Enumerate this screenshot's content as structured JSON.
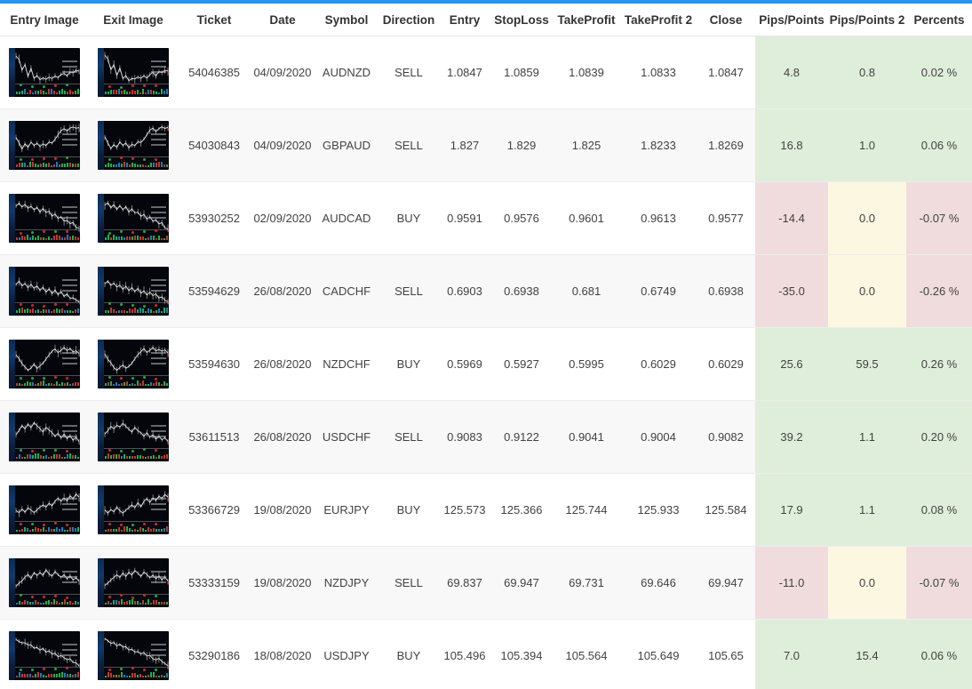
{
  "theme": {
    "accent": "#2196f3",
    "positive_bg": "#dfeeda",
    "negative_bg": "#f0dcdc",
    "zero_bg": "#fcf7e1",
    "row_odd_bg": "#ffffff",
    "row_even_bg": "#f8f8f8"
  },
  "table": {
    "columns": [
      {
        "key": "entry_image",
        "label": "Entry Image"
      },
      {
        "key": "exit_image",
        "label": "Exit Image"
      },
      {
        "key": "ticket",
        "label": "Ticket"
      },
      {
        "key": "date",
        "label": "Date"
      },
      {
        "key": "symbol",
        "label": "Symbol"
      },
      {
        "key": "direction",
        "label": "Direction"
      },
      {
        "key": "entry",
        "label": "Entry"
      },
      {
        "key": "stoploss",
        "label": "StopLoss"
      },
      {
        "key": "takeprofit",
        "label": "TakeProfit"
      },
      {
        "key": "takeprofit2",
        "label": "TakeProfit 2"
      },
      {
        "key": "close",
        "label": "Close"
      },
      {
        "key": "pips",
        "label": "Pips/Points"
      },
      {
        "key": "pips2",
        "label": "Pips/Points 2"
      },
      {
        "key": "percents",
        "label": "Percents"
      }
    ],
    "rows": [
      {
        "ticket": "54046385",
        "date": "04/09/2020",
        "symbol": "AUDNZD",
        "direction": "SELL",
        "entry": "1.0847",
        "stoploss": "1.0859",
        "takeprofit": "1.0839",
        "takeprofit2": "1.0833",
        "close": "1.0847",
        "pips": "4.8",
        "pips2": "0.8",
        "percents": "0.02 %",
        "pips_state": "pos",
        "pips2_state": "pos",
        "percents_state": "pos",
        "entry_chart": "downtrend-consolidation",
        "exit_chart": "downtrend-consolidation"
      },
      {
        "ticket": "54030843",
        "date": "04/09/2020",
        "symbol": "GBPAUD",
        "direction": "SELL",
        "entry": "1.827",
        "stoploss": "1.829",
        "takeprofit": "1.825",
        "takeprofit2": "1.8233",
        "close": "1.8269",
        "pips": "16.8",
        "pips2": "1.0",
        "percents": "0.06 %",
        "pips_state": "pos",
        "pips2_state": "pos",
        "percents_state": "pos",
        "entry_chart": "range-breakout-up",
        "exit_chart": "range-breakout-up"
      },
      {
        "ticket": "53930252",
        "date": "02/09/2020",
        "symbol": "AUDCAD",
        "direction": "BUY",
        "entry": "0.9591",
        "stoploss": "0.9576",
        "takeprofit": "0.9601",
        "takeprofit2": "0.9613",
        "close": "0.9577",
        "pips": "-14.4",
        "pips2": "0.0",
        "percents": "-0.07 %",
        "pips_state": "neg",
        "pips2_state": "zero",
        "percents_state": "neg",
        "entry_chart": "choppy-decline",
        "exit_chart": "choppy-decline"
      },
      {
        "ticket": "53594629",
        "date": "26/08/2020",
        "symbol": "CADCHF",
        "direction": "SELL",
        "entry": "0.6903",
        "stoploss": "0.6938",
        "takeprofit": "0.681",
        "takeprofit2": "0.6749",
        "close": "0.6938",
        "pips": "-35.0",
        "pips2": "0.0",
        "percents": "-0.26 %",
        "pips_state": "neg",
        "pips2_state": "zero",
        "percents_state": "neg",
        "entry_chart": "sideways-dip",
        "exit_chart": "sideways-dip"
      },
      {
        "ticket": "53594630",
        "date": "26/08/2020",
        "symbol": "NZDCHF",
        "direction": "BUY",
        "entry": "0.5969",
        "stoploss": "0.5927",
        "takeprofit": "0.5995",
        "takeprofit2": "0.6029",
        "close": "0.6029",
        "pips": "25.6",
        "pips2": "59.5",
        "percents": "0.26 %",
        "pips_state": "pos",
        "pips2_state": "pos",
        "percents_state": "pos",
        "entry_chart": "v-recovery",
        "exit_chart": "v-recovery"
      },
      {
        "ticket": "53611513",
        "date": "26/08/2020",
        "symbol": "USDCHF",
        "direction": "SELL",
        "entry": "0.9083",
        "stoploss": "0.9122",
        "takeprofit": "0.9041",
        "takeprofit2": "0.9004",
        "close": "0.9082",
        "pips": "39.2",
        "pips2": "1.1",
        "percents": "0.20 %",
        "pips_state": "pos",
        "pips2_state": "pos",
        "percents_state": "pos",
        "entry_chart": "peak-decline",
        "exit_chart": "peak-decline"
      },
      {
        "ticket": "53366729",
        "date": "19/08/2020",
        "symbol": "EURJPY",
        "direction": "BUY",
        "entry": "125.573",
        "stoploss": "125.366",
        "takeprofit": "125.744",
        "takeprofit2": "125.933",
        "close": "125.584",
        "pips": "17.9",
        "pips2": "1.1",
        "percents": "0.08 %",
        "pips_state": "pos",
        "pips2_state": "pos",
        "percents_state": "pos",
        "entry_chart": "base-rise",
        "exit_chart": "base-rise"
      },
      {
        "ticket": "53333159",
        "date": "19/08/2020",
        "symbol": "NZDJPY",
        "direction": "SELL",
        "entry": "69.837",
        "stoploss": "69.947",
        "takeprofit": "69.731",
        "takeprofit2": "69.646",
        "close": "69.947",
        "pips": "-11.0",
        "pips2": "0.0",
        "percents": "-0.07 %",
        "pips_state": "neg",
        "pips2_state": "zero",
        "percents_state": "neg",
        "entry_chart": "rally-top",
        "exit_chart": "rally-top"
      },
      {
        "ticket": "53290186",
        "date": "18/08/2020",
        "symbol": "USDJPY",
        "direction": "BUY",
        "entry": "105.496",
        "stoploss": "105.394",
        "takeprofit": "105.564",
        "takeprofit2": "105.649",
        "close": "105.65",
        "pips": "7.0",
        "pips2": "15.4",
        "percents": "0.06 %",
        "pips_state": "pos",
        "pips2_state": "pos",
        "percents_state": "pos",
        "entry_chart": "steady-decline",
        "exit_chart": "steady-decline"
      }
    ]
  }
}
